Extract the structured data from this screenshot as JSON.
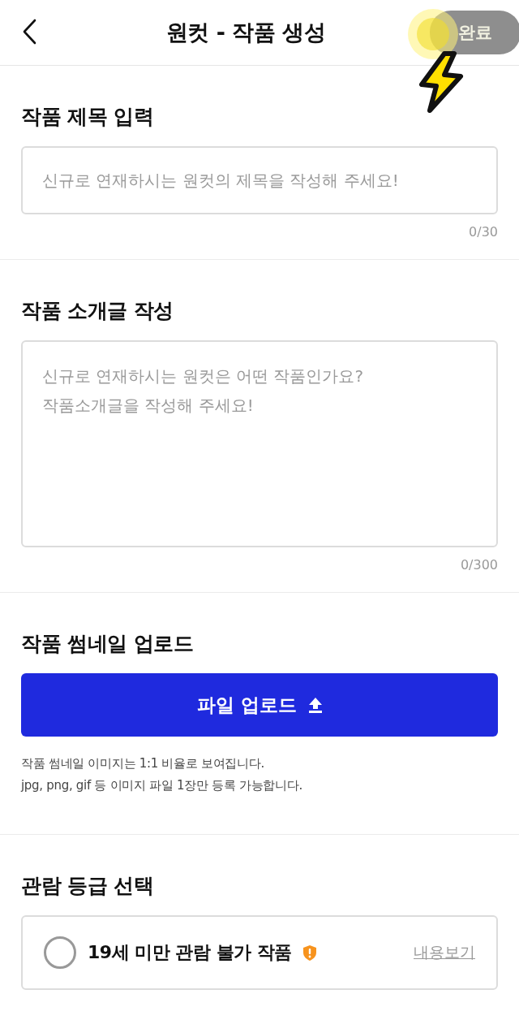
{
  "header": {
    "title": "원컷 - 작품 생성",
    "done_button": {
      "label": "완료",
      "disabled": true
    }
  },
  "title_section": {
    "heading": "작품 제목 입력",
    "placeholder": "신규로 연재하시는 원컷의 제목을 작성해 주세요!",
    "counter": "0/30"
  },
  "intro_section": {
    "heading": "작품 소개글 작성",
    "placeholder": "신규로 연재하시는 원컷은 어떤 작품인가요?\n작품소개글을 작성해 주세요!",
    "counter": "0/300"
  },
  "thumbnail_section": {
    "heading": "작품 썸네일 업로드",
    "upload_button": "파일 업로드",
    "notes": [
      "작품 썸네일 이미지는 1:1 비율로 보여집니다.",
      "jpg, png, gif 등 이미지 파일 1장만 등록 가능합니다."
    ]
  },
  "rating_section": {
    "heading": "관람 등급 선택",
    "options": [
      {
        "label": "19세 미만 관람 불가 작품",
        "selected": false,
        "link": "내용보기"
      }
    ]
  }
}
